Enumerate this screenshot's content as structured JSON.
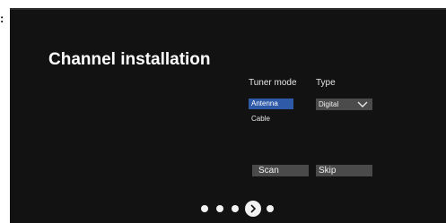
{
  "screen": {
    "title": "Channel installation",
    "tuner_mode": {
      "header": "Tuner mode",
      "options": [
        "Antenna",
        "Cable"
      ],
      "selected": "Antenna"
    },
    "type": {
      "header": "Type",
      "value": "Digital"
    },
    "buttons": {
      "scan_label": "Scan",
      "skip_label": "Skip"
    },
    "pager": {
      "total_steps": 5,
      "current_step": 4
    }
  },
  "colors": {
    "background": "#121212",
    "selected_option": "#2f5aa8",
    "button": "#4a4a4a",
    "text": "#ffffff"
  }
}
